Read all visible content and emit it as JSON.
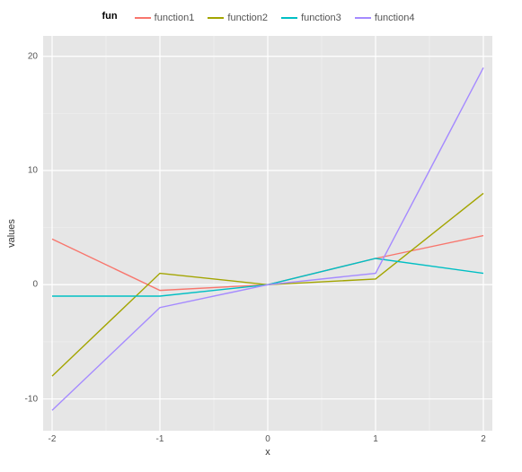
{
  "chart_data": {
    "type": "line",
    "legend_title": "fun",
    "xlabel": "x",
    "ylabel": "values",
    "xlim": [
      -2,
      2
    ],
    "ylim": [
      -12,
      21
    ],
    "x_ticks": [
      -2,
      -1,
      0,
      1,
      2
    ],
    "y_ticks": [
      -10,
      0,
      10,
      20
    ],
    "x": [
      -2,
      -1,
      0,
      1,
      2
    ],
    "series": [
      {
        "name": "function1",
        "color": "#F8766D",
        "values": [
          4,
          -0.5,
          0,
          2.3,
          4.3
        ]
      },
      {
        "name": "function2",
        "color": "#A3A500",
        "values": [
          -8,
          1,
          0,
          0.5,
          8
        ]
      },
      {
        "name": "function3",
        "color": "#00BFC4",
        "values": [
          -1,
          -1,
          0,
          2.3,
          1
        ]
      },
      {
        "name": "function4",
        "color": "#A58AFF",
        "values": [
          -11,
          -2,
          0,
          1,
          19
        ]
      }
    ]
  }
}
